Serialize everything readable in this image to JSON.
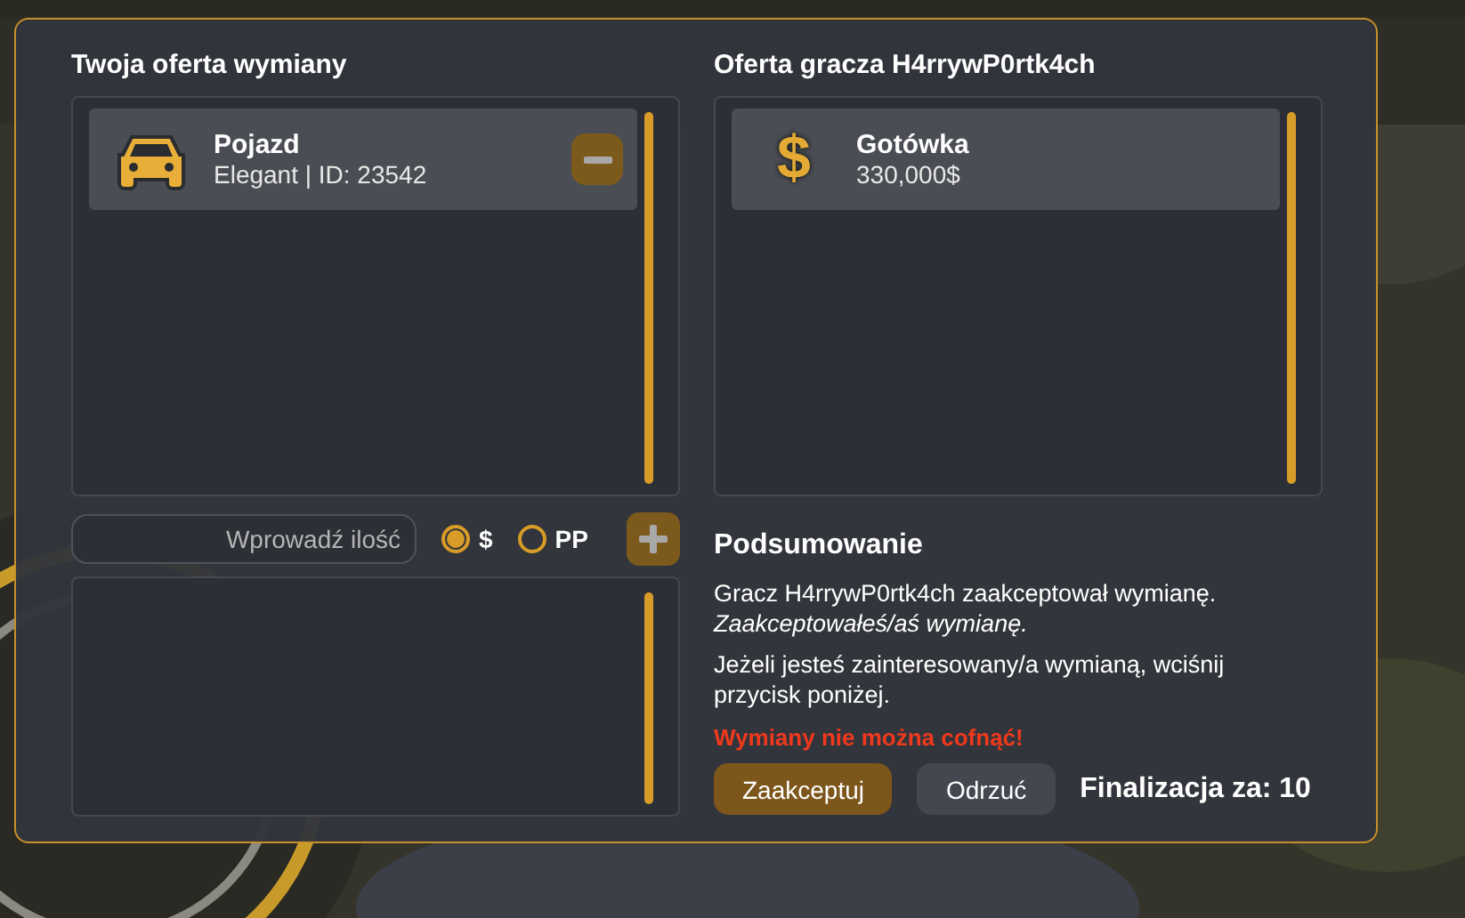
{
  "my_offer": {
    "title": "Twoja oferta wymiany",
    "items": [
      {
        "kind": "vehicle",
        "name": "Pojazd",
        "detail": "Elegant | ID: 23542",
        "removable": true
      }
    ]
  },
  "amount": {
    "placeholder": "Wprowadź ilość"
  },
  "currencies": [
    {
      "label": "$",
      "selected": true
    },
    {
      "label": "PP",
      "selected": false
    }
  ],
  "their_offer": {
    "title": "Oferta gracza H4rrywP0rtk4ch",
    "items": [
      {
        "kind": "cash",
        "icon": "$",
        "name": "Gotówka",
        "detail": "330,000$",
        "removable": false
      }
    ]
  },
  "summary": {
    "title": "Podsumowanie",
    "lines": [
      {
        "text": "Gracz H4rrywP0rtk4ch zaakceptował wymianę.",
        "kind": "normal"
      },
      {
        "text": "Zaakceptowałeś/aś wymianę.",
        "kind": "italic"
      },
      {
        "text": "Jeżeli jesteś zainteresowany/a wymianą, wciśnij przycisk poniżej.",
        "kind": "paragraph"
      },
      {
        "text": "Wymiany nie można cofnąć!",
        "kind": "warning"
      }
    ]
  },
  "buttons": [
    {
      "label": "Zaakceptuj",
      "kind": "primary"
    },
    {
      "label": "Odrzuć",
      "kind": "secondary"
    }
  ],
  "timer": "Finalizacja za: 10"
}
